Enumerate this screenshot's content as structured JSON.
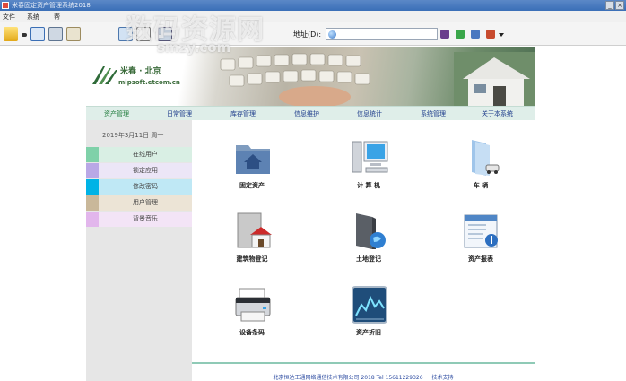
{
  "window": {
    "title": "米春固定资产管理系统2018"
  },
  "menu": [
    "文件",
    "系统",
    "帮"
  ],
  "address": {
    "label": "地址(D):",
    "value": ""
  },
  "banner": {
    "brand": "米春 · 北京",
    "domain": "mipsoft.etcom.cn"
  },
  "nav": [
    {
      "label": "资产管理",
      "active": true
    },
    {
      "label": "日常管理",
      "active": false
    },
    {
      "label": "库存管理",
      "active": false
    },
    {
      "label": "信息维护",
      "active": false
    },
    {
      "label": "信息统计",
      "active": false
    },
    {
      "label": "系统管理",
      "active": false
    },
    {
      "label": "关于本系统",
      "active": false
    }
  ],
  "sidebar": {
    "date": "2019年3月11日  周一",
    "items": [
      {
        "label": "在线用户",
        "swatch": "#7fd1a9",
        "bg": "#d9efe4"
      },
      {
        "label": "锁定应用",
        "swatch": "#b9a8e6",
        "bg": "#ece6f7"
      },
      {
        "label": "修改密码",
        "swatch": "#00b3e6",
        "bg": "#bfe8f5"
      },
      {
        "label": "用户管理",
        "swatch": "#c9b89a",
        "bg": "#ece4d6"
      },
      {
        "label": "背景音乐",
        "swatch": "#e2b6ec",
        "bg": "#f3e4f6"
      }
    ]
  },
  "tiles": [
    {
      "label": "固定资产",
      "icon": "folder-home-icon"
    },
    {
      "label": "计 算 机",
      "icon": "computer-icon"
    },
    {
      "label": "车  辆",
      "icon": "vehicle-folder-icon"
    },
    {
      "label": "建筑物登记",
      "icon": "building-icon"
    },
    {
      "label": "土地登记",
      "icon": "land-globe-icon"
    },
    {
      "label": "资产报表",
      "icon": "report-icon"
    },
    {
      "label": "设备条码",
      "icon": "printer-icon"
    },
    {
      "label": "资产折旧",
      "icon": "chart-icon"
    }
  ],
  "footer": {
    "copyright": "北京恒达王通网络通信技术有限公司 2018  Tel 15611229326",
    "support": "技术支持"
  },
  "watermark": {
    "main": "数码资源网",
    "sub": "smzy.com"
  }
}
